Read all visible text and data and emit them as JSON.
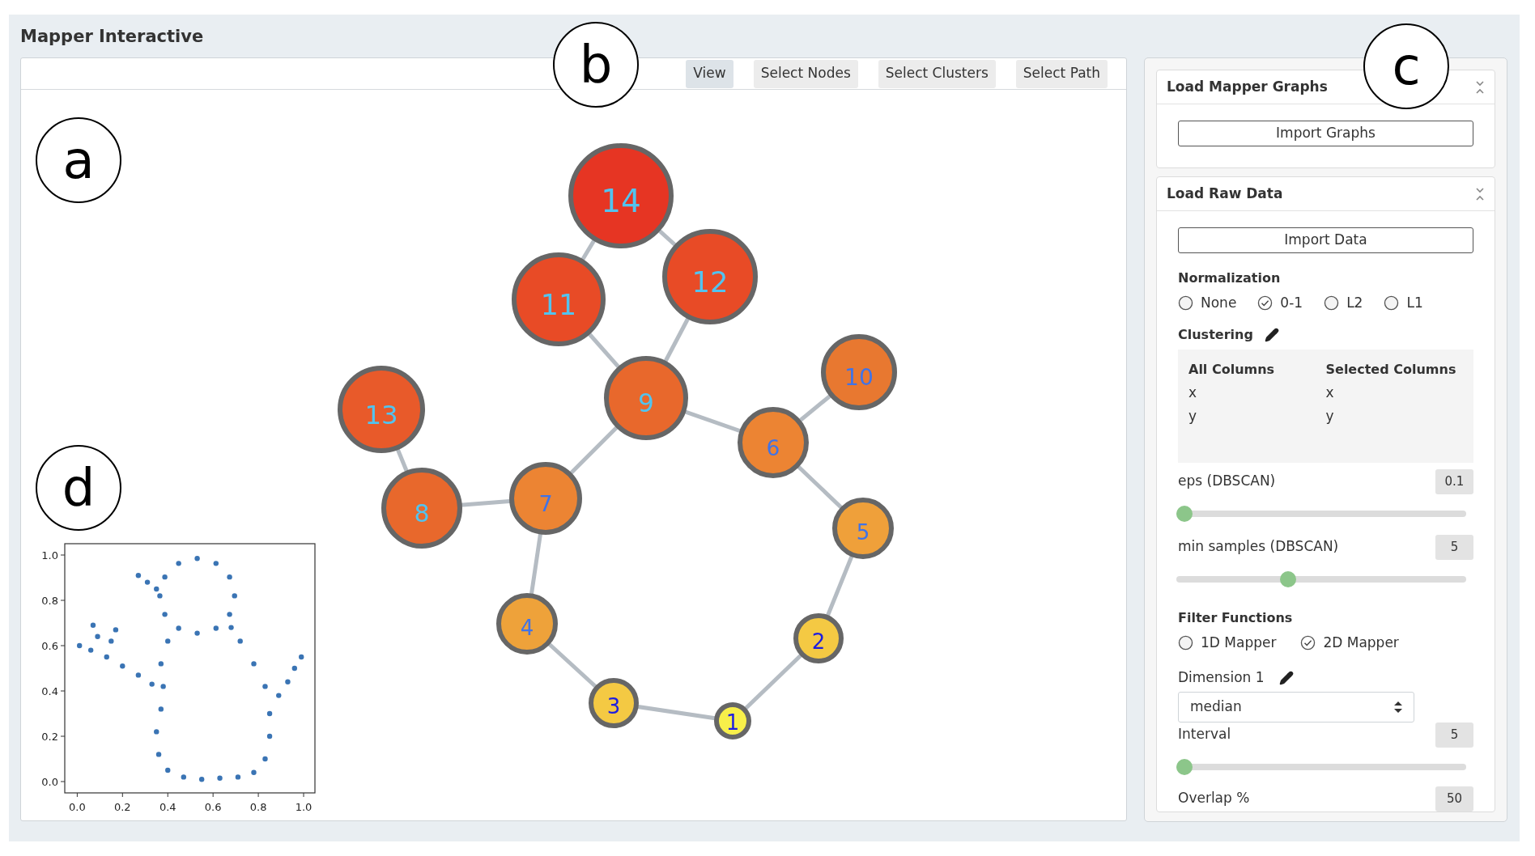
{
  "title": "Mapper Interactive",
  "toolbar": {
    "tabs": [
      {
        "label": "View",
        "selected": true
      },
      {
        "label": "Select Nodes",
        "selected": false
      },
      {
        "label": "Select Clusters",
        "selected": false
      },
      {
        "label": "Select Path",
        "selected": false
      }
    ]
  },
  "graph": {
    "nodes": [
      {
        "label": "1",
        "color": "#f7ef4a"
      },
      {
        "label": "2",
        "color": "#f4c943"
      },
      {
        "label": "3",
        "color": "#f4c943"
      },
      {
        "label": "4",
        "color": "#eea23a"
      },
      {
        "label": "5",
        "color": "#efa03a"
      },
      {
        "label": "6",
        "color": "#ec8433"
      },
      {
        "label": "7",
        "color": "#ec8433"
      },
      {
        "label": "8",
        "color": "#e8682c"
      },
      {
        "label": "9",
        "color": "#e8682c"
      },
      {
        "label": "10",
        "color": "#e87830"
      },
      {
        "label": "11",
        "color": "#e84b26"
      },
      {
        "label": "12",
        "color": "#e84b26"
      },
      {
        "label": "13",
        "color": "#e85a2a"
      },
      {
        "label": "14",
        "color": "#e63523"
      }
    ]
  },
  "scatter_plot": {
    "chart_data": {
      "type": "scatter",
      "xlim": [
        -0.055,
        1.05
      ],
      "ylim": [
        -0.05,
        1.05
      ],
      "xticks": [
        {
          "value": 0,
          "label": "0.0"
        },
        0.2,
        0.4,
        0.6,
        0.8,
        {
          "value": 1,
          "label": "1.0"
        }
      ],
      "yticks": [
        {
          "value": 0,
          "label": "0.0"
        },
        0.2,
        0.4,
        0.6,
        0.8,
        {
          "value": 1,
          "label": "1.0"
        }
      ],
      "x": [
        0.695,
        0.673,
        0.613,
        0.53,
        0.448,
        0.387,
        0.365,
        0.387,
        0.448,
        0.53,
        0.613,
        0.673,
        0.27,
        0.31,
        0.35,
        0.4,
        0.37,
        0.38,
        0.37,
        0.35,
        0.36,
        0.4,
        0.47,
        0.55,
        0.63,
        0.71,
        0.78,
        0.83,
        0.85,
        0.85,
        0.83,
        0.78,
        0.72,
        0.68,
        0.33,
        0.27,
        0.2,
        0.13,
        0.06,
        0.01,
        0.09,
        0.07,
        0.15,
        0.17,
        0.89,
        0.93,
        0.96,
        0.99
      ],
      "series": [
        {
          "color": "#3a74b4",
          "values": [
            0.82,
            0.903,
            0.963,
            0.985,
            0.963,
            0.903,
            0.82,
            0.738,
            0.677,
            0.655,
            0.677,
            0.738,
            0.91,
            0.88,
            0.85,
            0.62,
            0.52,
            0.42,
            0.32,
            0.22,
            0.12,
            0.05,
            0.02,
            0.01,
            0.015,
            0.02,
            0.04,
            0.1,
            0.2,
            0.3,
            0.42,
            0.52,
            0.62,
            0.68,
            0.43,
            0.47,
            0.51,
            0.55,
            0.58,
            0.6,
            0.64,
            0.69,
            0.62,
            0.67,
            0.38,
            0.44,
            0.5,
            0.55
          ]
        }
      ]
    }
  },
  "annotations": [
    "a",
    "b",
    "c",
    "d"
  ],
  "sidebar": {
    "load_graphs": {
      "title": "Load Mapper Graphs",
      "button": "Import Graphs"
    },
    "load_data": {
      "title": "Load Raw Data",
      "button": "Import Data",
      "normalization": {
        "label": "Normalization",
        "options": [
          {
            "label": "None",
            "selected": false
          },
          {
            "label": "0-1",
            "selected": true
          },
          {
            "label": "L2",
            "selected": false
          },
          {
            "label": "L1",
            "selected": false
          }
        ]
      },
      "clustering": {
        "label": "Clustering",
        "columns": [
          {
            "heading": "All Columns",
            "items": [
              "x",
              "y"
            ]
          },
          {
            "heading": "Selected Columns",
            "items": [
              "x",
              "y"
            ]
          }
        ]
      },
      "sliders": [
        {
          "label": "eps (DBSCAN)",
          "value": "0.1",
          "level": 0
        },
        {
          "label": "min samples (DBSCAN)",
          "value": "5",
          "level": 0.38
        }
      ],
      "filter_functions": {
        "label": "Filter Functions",
        "options": [
          {
            "label": "1D Mapper",
            "selected": false
          },
          {
            "label": "2D Mapper",
            "selected": true
          }
        ]
      },
      "dimension": {
        "label": "Dimension 1",
        "value": "median"
      },
      "interval": {
        "label": "Interval",
        "value": "5",
        "level": 0
      },
      "overlap": {
        "label": "Overlap %",
        "value": "50"
      }
    }
  }
}
